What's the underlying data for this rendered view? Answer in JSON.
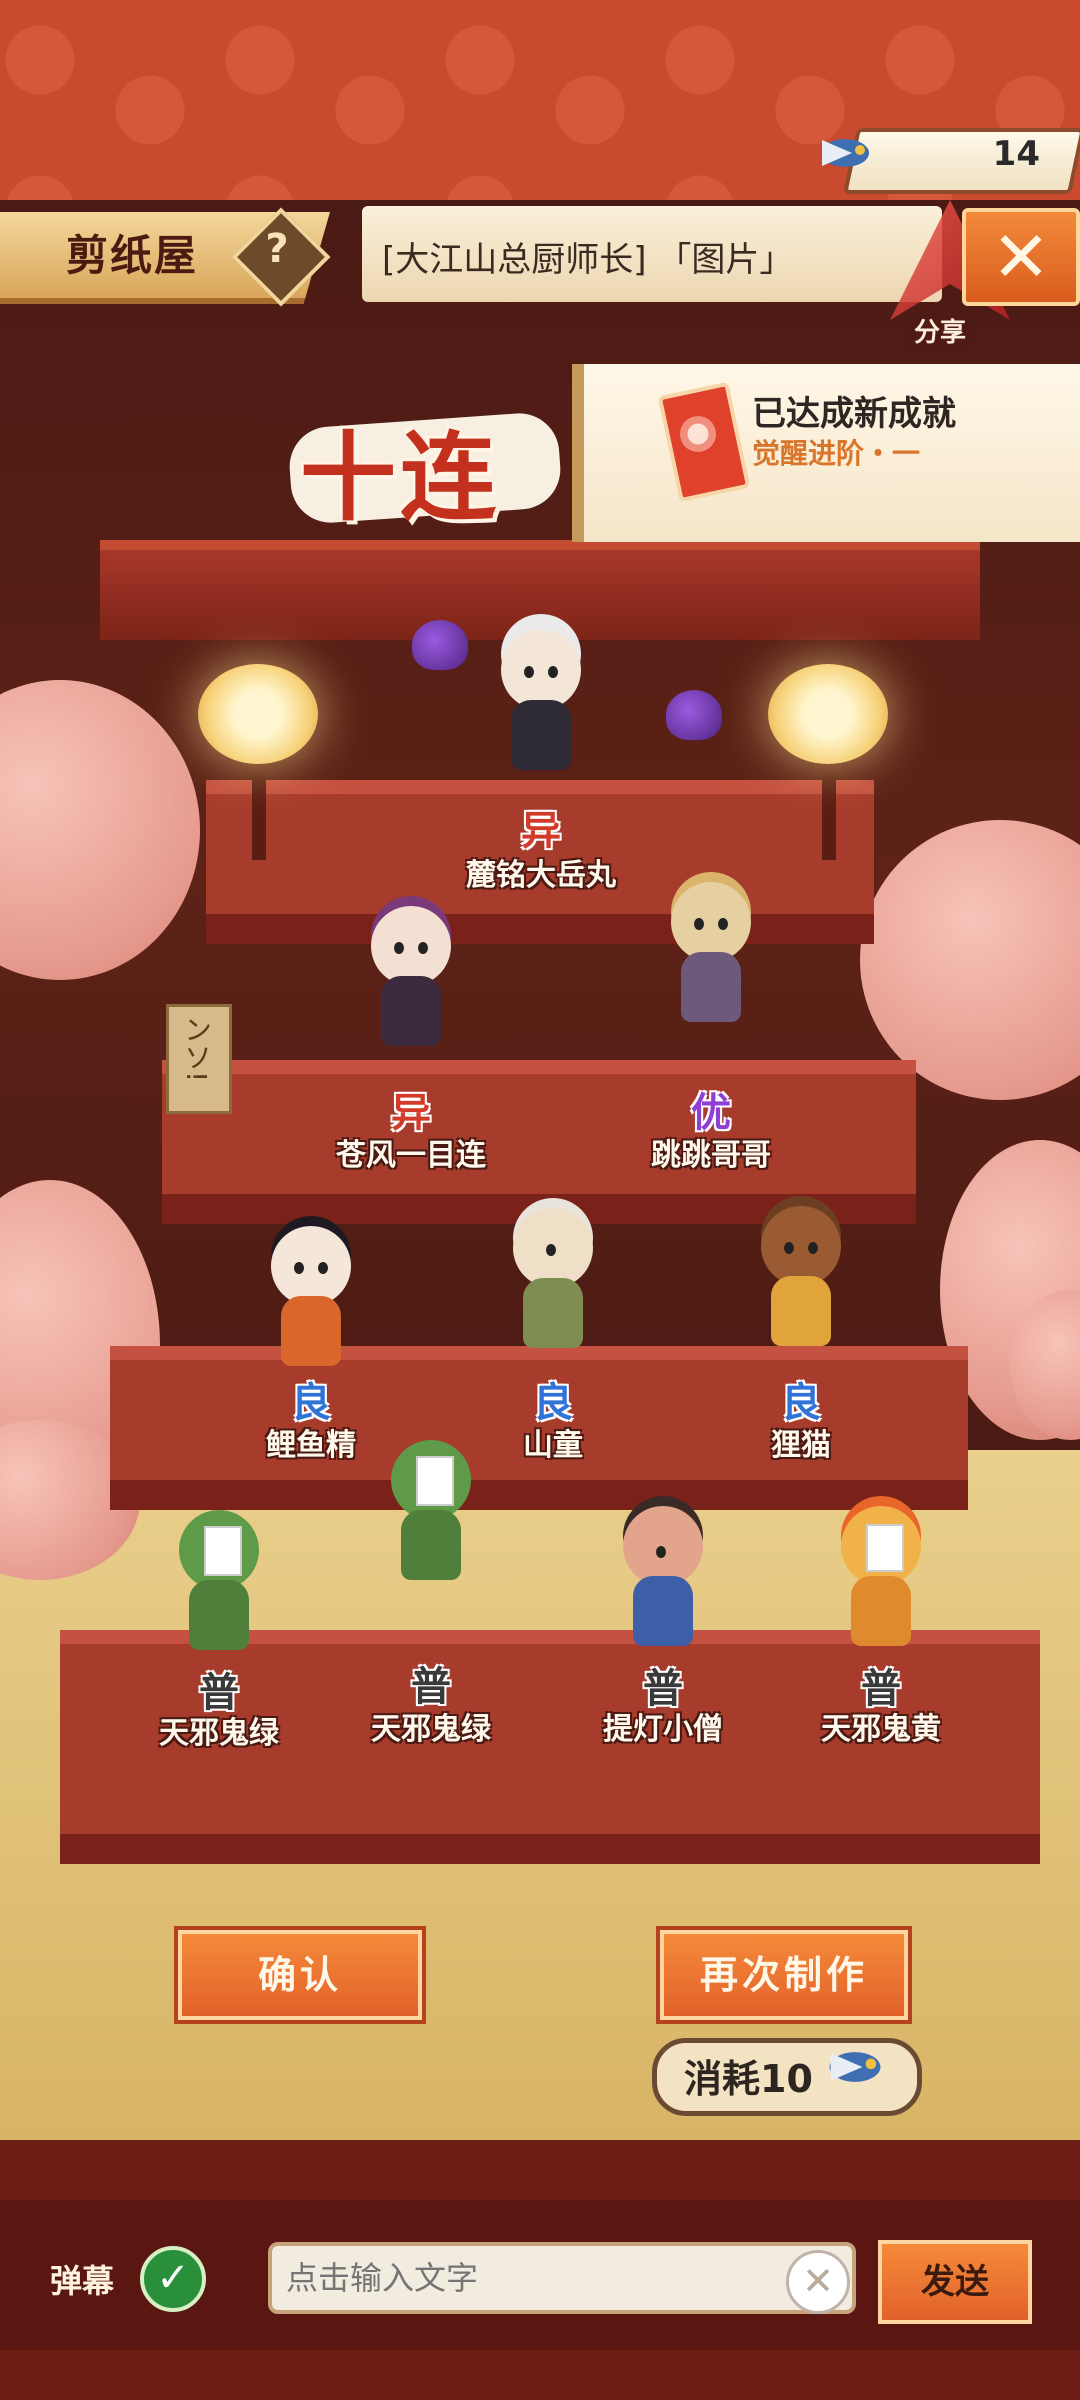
{
  "currency": {
    "value": "14",
    "icon": "paper-swallow-icon"
  },
  "header": {
    "title": "剪纸屋",
    "help_label": "?",
    "message": "[大江山总厨师长] 「图片」",
    "close_label": "✕",
    "share_label": "分享"
  },
  "banner": {
    "ten_pull": "十连"
  },
  "achievement": {
    "title": "已达成新成就",
    "subtitle": "觉醒进阶・一"
  },
  "characters": [
    {
      "rarity": "异",
      "name": "麓铭大岳丸",
      "rarity_class": "sp"
    },
    {
      "rarity": "异",
      "name": "苍风一目连",
      "rarity_class": "sp"
    },
    {
      "rarity": "优",
      "name": "跳跳哥哥",
      "rarity_class": "ssr"
    },
    {
      "rarity": "良",
      "name": "鲤鱼精",
      "rarity_class": "sr"
    },
    {
      "rarity": "良",
      "name": "山童",
      "rarity_class": "sr"
    },
    {
      "rarity": "良",
      "name": "狸猫",
      "rarity_class": "sr"
    },
    {
      "rarity": "普",
      "name": "天邪鬼绿",
      "rarity_class": "r"
    },
    {
      "rarity": "普",
      "name": "天邪鬼绿",
      "rarity_class": "r"
    },
    {
      "rarity": "普",
      "name": "提灯小僧",
      "rarity_class": "r"
    },
    {
      "rarity": "普",
      "name": "天邪鬼黄",
      "rarity_class": "r"
    }
  ],
  "sign_text": "ンソ!",
  "actions": {
    "confirm_label": "确认",
    "again_label": "再次制作",
    "cost_label": "消耗10"
  },
  "chat": {
    "danmu_label": "弹幕",
    "danmu_enabled": true,
    "input_placeholder": "点击输入文字",
    "input_value": "",
    "clear_label": "✕",
    "send_label": "发送"
  },
  "colors": {
    "accent_orange": "#e2622a",
    "rarity_sp": "#d23a2a",
    "rarity_ssr": "#8f3fd6",
    "rarity_sr": "#2f73d6",
    "rarity_r": "#3a3a3a"
  }
}
